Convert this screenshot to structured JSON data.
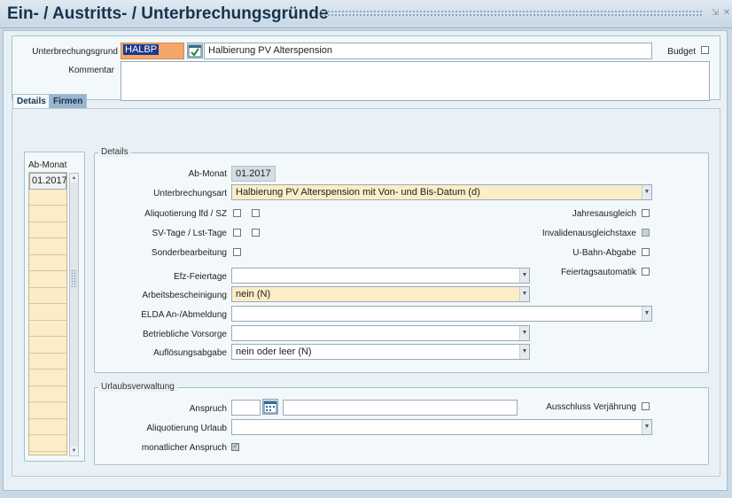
{
  "window": {
    "title": "Ein- / Austritts- / Unterbrechungsgründe",
    "minimize_glyph": "⇲",
    "close_glyph": "✕"
  },
  "header": {
    "unterbrechungsgrund_label": "Unterbrechungsgrund",
    "code_value": "HALBP",
    "description_value": "Halbierung PV Alterspension",
    "budget_label": "Budget",
    "kommentar_label": "Kommentar",
    "kommentar_value": ""
  },
  "tabs": [
    {
      "label": "Details",
      "active": true
    },
    {
      "label": "Firmen",
      "active": false
    }
  ],
  "list": {
    "header": "Ab-Monat",
    "rows": [
      "01.2017"
    ]
  },
  "details": {
    "group_title": "Details",
    "ab_monat_label": "Ab-Monat",
    "ab_monat_value": "01.2017",
    "unterbrechungsart_label": "Unterbrechungsart",
    "unterbrechungsart_value": "Halbierung PV Alterspension mit Von- und Bis-Datum (d)",
    "aliquotierung_label": "Aliquotierung lfd / SZ",
    "svtage_label": "SV-Tage / Lst-Tage",
    "sonderbearbeitung_label": "Sonderbearbeitung",
    "jahresausgleich_label": "Jahresausgleich",
    "invalidenausgleichstaxe_label": "Invalidenausgleichstaxe",
    "ubahn_label": "U-Bahn-Abgabe",
    "feiertagsautomatik_label": "Feiertagsautomatik",
    "efz_label": "Efz-Feiertage",
    "efz_value": "",
    "arbeitsbescheinigung_label": "Arbeitsbescheinigung",
    "arbeitsbescheinigung_value": "nein (N)",
    "elda_label": "ELDA An-/Abmeldung",
    "elda_value": "",
    "vorsorge_label": "Betriebliche Vorsorge",
    "vorsorge_value": "",
    "aufloesung_label": "Auflösungsabgabe",
    "aufloesung_value": "nein oder leer (N)"
  },
  "urlaub": {
    "group_title": "Urlaubsverwaltung",
    "anspruch_label": "Anspruch",
    "anspruch_value": "",
    "anspruch_desc": "",
    "ausschluss_label": "Ausschluss Verjährung",
    "aliquotierung_label": "Aliquotierung Urlaub",
    "aliquotierung_value": "",
    "monatlich_label": "monatlicher Anspruch"
  },
  "colors": {
    "accent": "#1a3a8c",
    "highlight_code": "#f4a66a",
    "yellow_field": "#fbedc8",
    "panel_border": "#9fc4cc"
  }
}
